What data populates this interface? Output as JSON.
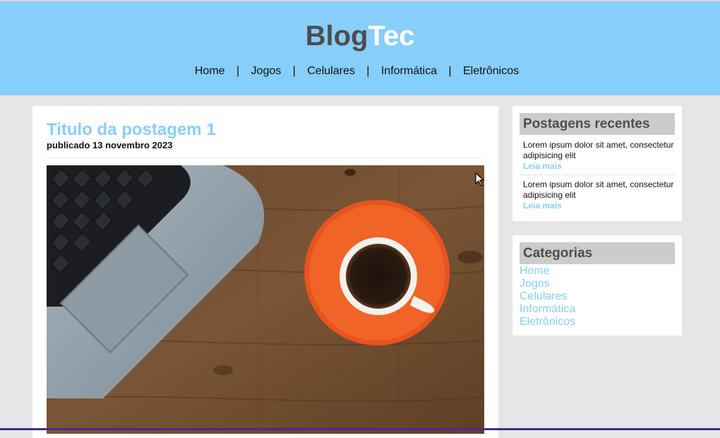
{
  "header": {
    "logo_part1": "Blog",
    "logo_part2": "Tec",
    "nav": [
      "Home",
      "Jogos",
      "Celulares",
      "Informática",
      "Eletrônicos"
    ],
    "separator": "|"
  },
  "post": {
    "title": "Titulo da postagem 1",
    "date": "publicado 13 novembro 2023",
    "image": "laptop-and-coffee-cup-on-wooden-table"
  },
  "sidebar": {
    "recent": {
      "title": "Postagens recentes",
      "items": [
        {
          "text": "Lorem ipsum dolor sit amet, consectetur adipisicing elit",
          "link": "Leia mais"
        },
        {
          "text": "Lorem ipsum dolor sit amet, consectetur adipisicing elit",
          "link": "Leia mais"
        }
      ]
    },
    "categories": {
      "title": "Categorias",
      "items": [
        "Home",
        "Jogos",
        "Celulares",
        "Informática",
        "Eletrônicos"
      ]
    }
  },
  "colors": {
    "accent": "#87cefa",
    "background": "#e6e6e6",
    "heading_gray": "#4d4d4d",
    "widget_head_bg": "#cccccc"
  }
}
